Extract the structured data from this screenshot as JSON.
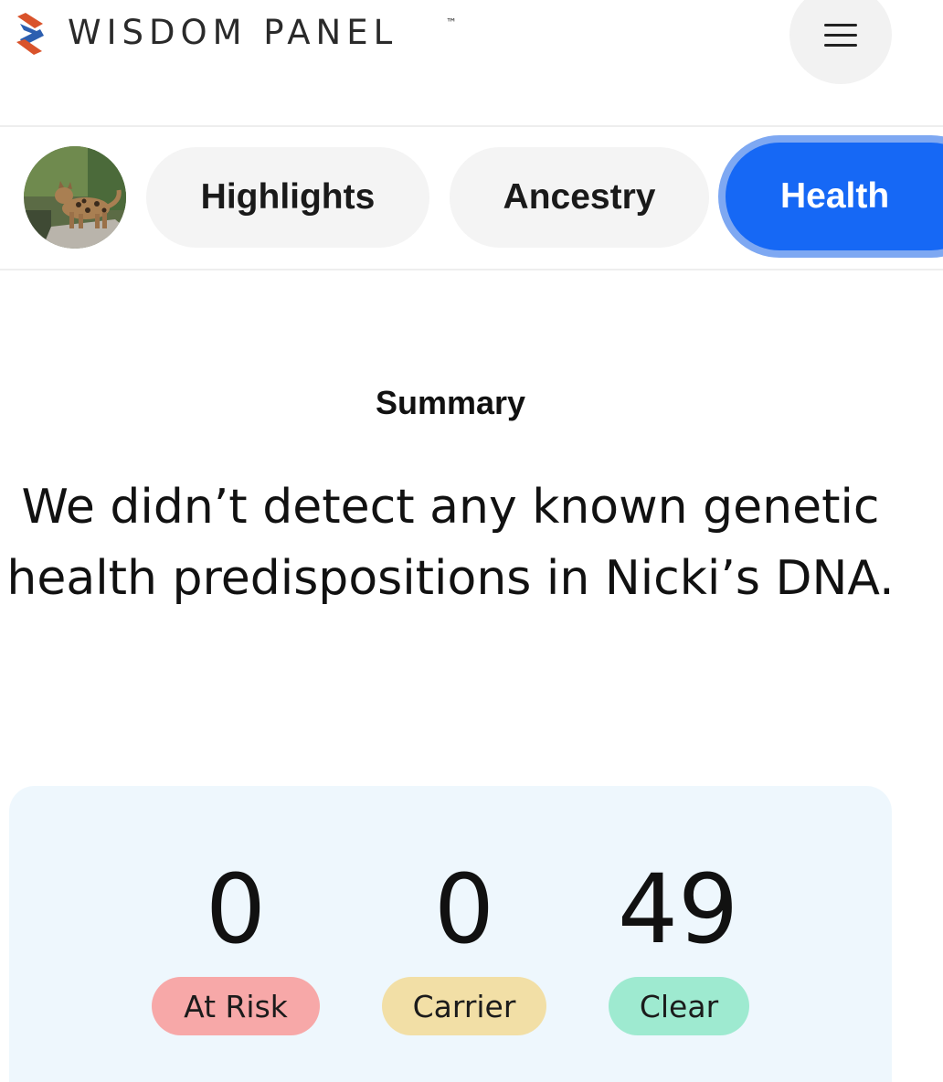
{
  "header": {
    "brand": "WISDOM PANEL",
    "trademark": "™",
    "logo_icon": "wisdom-panel-logo-icon",
    "menu_icon": "hamburger-menu-icon",
    "logo_colors": {
      "primary": "#d9532b",
      "secondary": "#2d5fb0"
    }
  },
  "pet": {
    "avatar_icon": "pet-avatar-photo"
  },
  "tabs": [
    {
      "label": "Highlights",
      "active": false
    },
    {
      "label": "Ancestry",
      "active": false
    },
    {
      "label": "Health",
      "active": true
    }
  ],
  "summary": {
    "heading": "Summary",
    "text": "We didn’t detect any known genetic health predispositions in Nicki’s DNA."
  },
  "stats": [
    {
      "value": "0",
      "label": "At Risk",
      "color": "#f7a8a8"
    },
    {
      "value": "0",
      "label": "Carrier",
      "color": "#f2dfa6"
    },
    {
      "value": "49",
      "label": "Clear",
      "color": "#9eead0"
    }
  ],
  "colors": {
    "accent": "#1668f5",
    "accent_ring": "#7ea8f2",
    "card_bg": "#eef7fd"
  }
}
